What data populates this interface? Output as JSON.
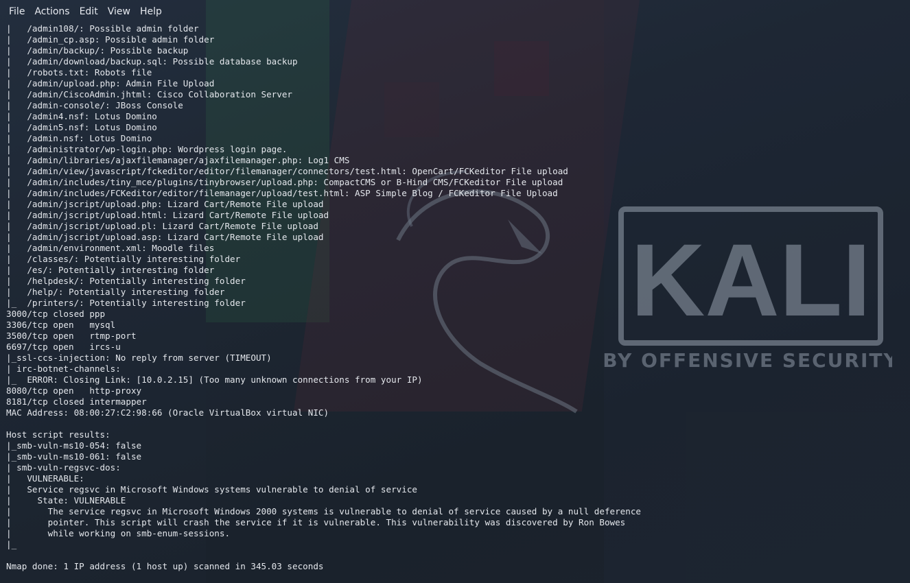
{
  "menubar": {
    "items": [
      "File",
      "Actions",
      "Edit",
      "View",
      "Help"
    ]
  },
  "desktop": {
    "logo_text": "KALI",
    "logo_tagline": "BY OFFENSIVE SECURITY"
  },
  "terminal": {
    "lines": [
      "|   /admin108/: Possible admin folder",
      "|   /admin_cp.asp: Possible admin folder",
      "|   /admin/backup/: Possible backup",
      "|   /admin/download/backup.sql: Possible database backup",
      "|   /robots.txt: Robots file",
      "|   /admin/upload.php: Admin File Upload",
      "|   /admin/CiscoAdmin.jhtml: Cisco Collaboration Server",
      "|   /admin-console/: JBoss Console",
      "|   /admin4.nsf: Lotus Domino",
      "|   /admin5.nsf: Lotus Domino",
      "|   /admin.nsf: Lotus Domino",
      "|   /administrator/wp-login.php: Wordpress login page.",
      "|   /admin/libraries/ajaxfilemanager/ajaxfilemanager.php: Log1 CMS",
      "|   /admin/view/javascript/fckeditor/editor/filemanager/connectors/test.html: OpenCart/FCKeditor File upload",
      "|   /admin/includes/tiny_mce/plugins/tinybrowser/upload.php: CompactCMS or B-Hind CMS/FCKeditor File upload",
      "|   /admin/includes/FCKeditor/editor/filemanager/upload/test.html: ASP Simple Blog / FCKeditor File Upload",
      "|   /admin/jscript/upload.php: Lizard Cart/Remote File upload",
      "|   /admin/jscript/upload.html: Lizard Cart/Remote File upload",
      "|   /admin/jscript/upload.pl: Lizard Cart/Remote File upload",
      "|   /admin/jscript/upload.asp: Lizard Cart/Remote File upload",
      "|   /admin/environment.xml: Moodle files",
      "|   /classes/: Potentially interesting folder",
      "|   /es/: Potentially interesting folder",
      "|   /helpdesk/: Potentially interesting folder",
      "|   /help/: Potentially interesting folder",
      "|_  /printers/: Potentially interesting folder",
      "3000/tcp closed ppp",
      "3306/tcp open   mysql",
      "3500/tcp open   rtmp-port",
      "6697/tcp open   ircs-u",
      "|_ssl-ccs-injection: No reply from server (TIMEOUT)",
      "| irc-botnet-channels:",
      "|_  ERROR: Closing Link: [10.0.2.15] (Too many unknown connections from your IP)",
      "8080/tcp open   http-proxy",
      "8181/tcp closed intermapper",
      "MAC Address: 08:00:27:C2:98:66 (Oracle VirtualBox virtual NIC)",
      "",
      "Host script results:",
      "|_smb-vuln-ms10-054: false",
      "|_smb-vuln-ms10-061: false",
      "| smb-vuln-regsvc-dos:",
      "|   VULNERABLE:",
      "|   Service regsvc in Microsoft Windows systems vulnerable to denial of service",
      "|     State: VULNERABLE",
      "|       The service regsvc in Microsoft Windows 2000 systems is vulnerable to denial of service caused by a null deference",
      "|       pointer. This script will crash the service if it is vulnerable. This vulnerability was discovered by Ron Bowes",
      "|       while working on smb-enum-sessions.",
      "|_",
      "",
      "Nmap done: 1 IP address (1 host up) scanned in 345.03 seconds"
    ]
  }
}
